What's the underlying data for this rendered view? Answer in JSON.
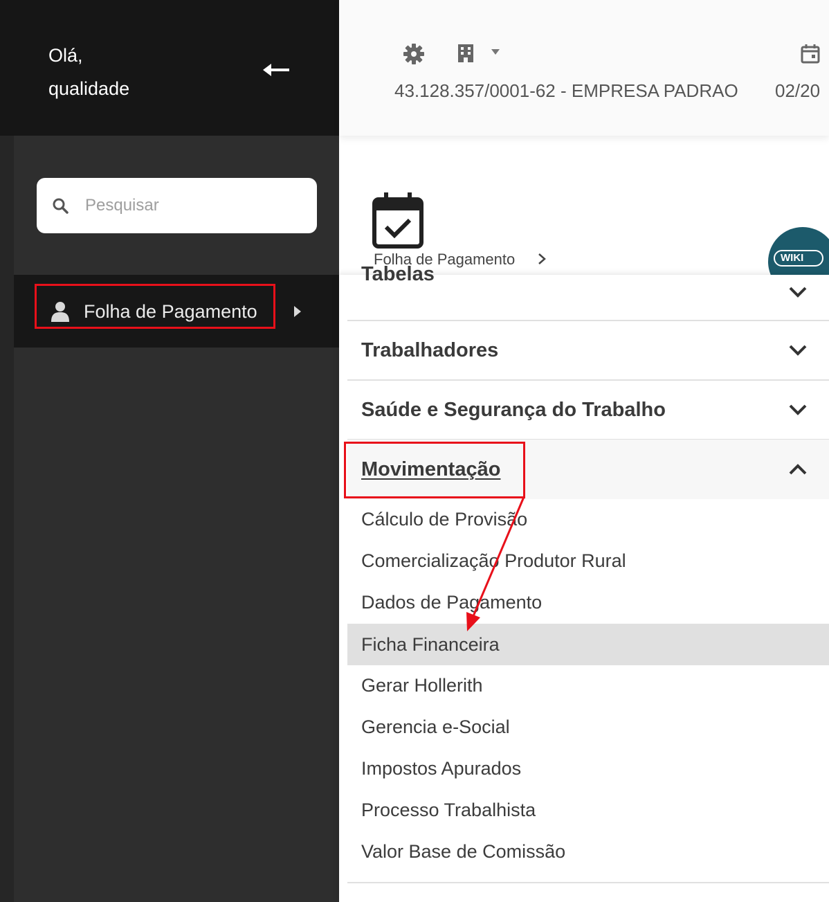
{
  "sidebar": {
    "greeting": "Olá,\nqualidade",
    "search": {
      "placeholder": "Pesquisar",
      "value": ""
    },
    "nav_item": {
      "label": "Folha de Pagamento"
    }
  },
  "topbar": {
    "company": "43.128.357/0001-62 - EMPRESA PADRAO",
    "date": "02/20"
  },
  "page": {
    "breadcrumb": "Folha de Pagamento",
    "wiki_label": "WIKI"
  },
  "menu": {
    "sections": [
      {
        "label": "Tabelas",
        "expanded": false
      },
      {
        "label": "Trabalhadores",
        "expanded": false
      },
      {
        "label": "Saúde e Segurança do Trabalho",
        "expanded": false
      },
      {
        "label": "Movimentação",
        "expanded": true
      }
    ],
    "items": [
      "Cálculo de Provisão",
      "Comercialização Produtor Rural",
      "Dados de Pagamento",
      "Ficha Financeira",
      "Gerar Hollerith",
      "Gerencia e-Social",
      "Impostos Apurados",
      "Processo Trabalhista",
      "Valor Base de Comissão"
    ],
    "selected_item": "Ficha Financeira"
  },
  "colors": {
    "sidebar_bg": "#2e2e2e",
    "sidebar_header": "#161616",
    "annotation_red": "#e8101a",
    "wiki_bg": "#1c5a6b",
    "selected_bg": "#e0e0e0"
  }
}
